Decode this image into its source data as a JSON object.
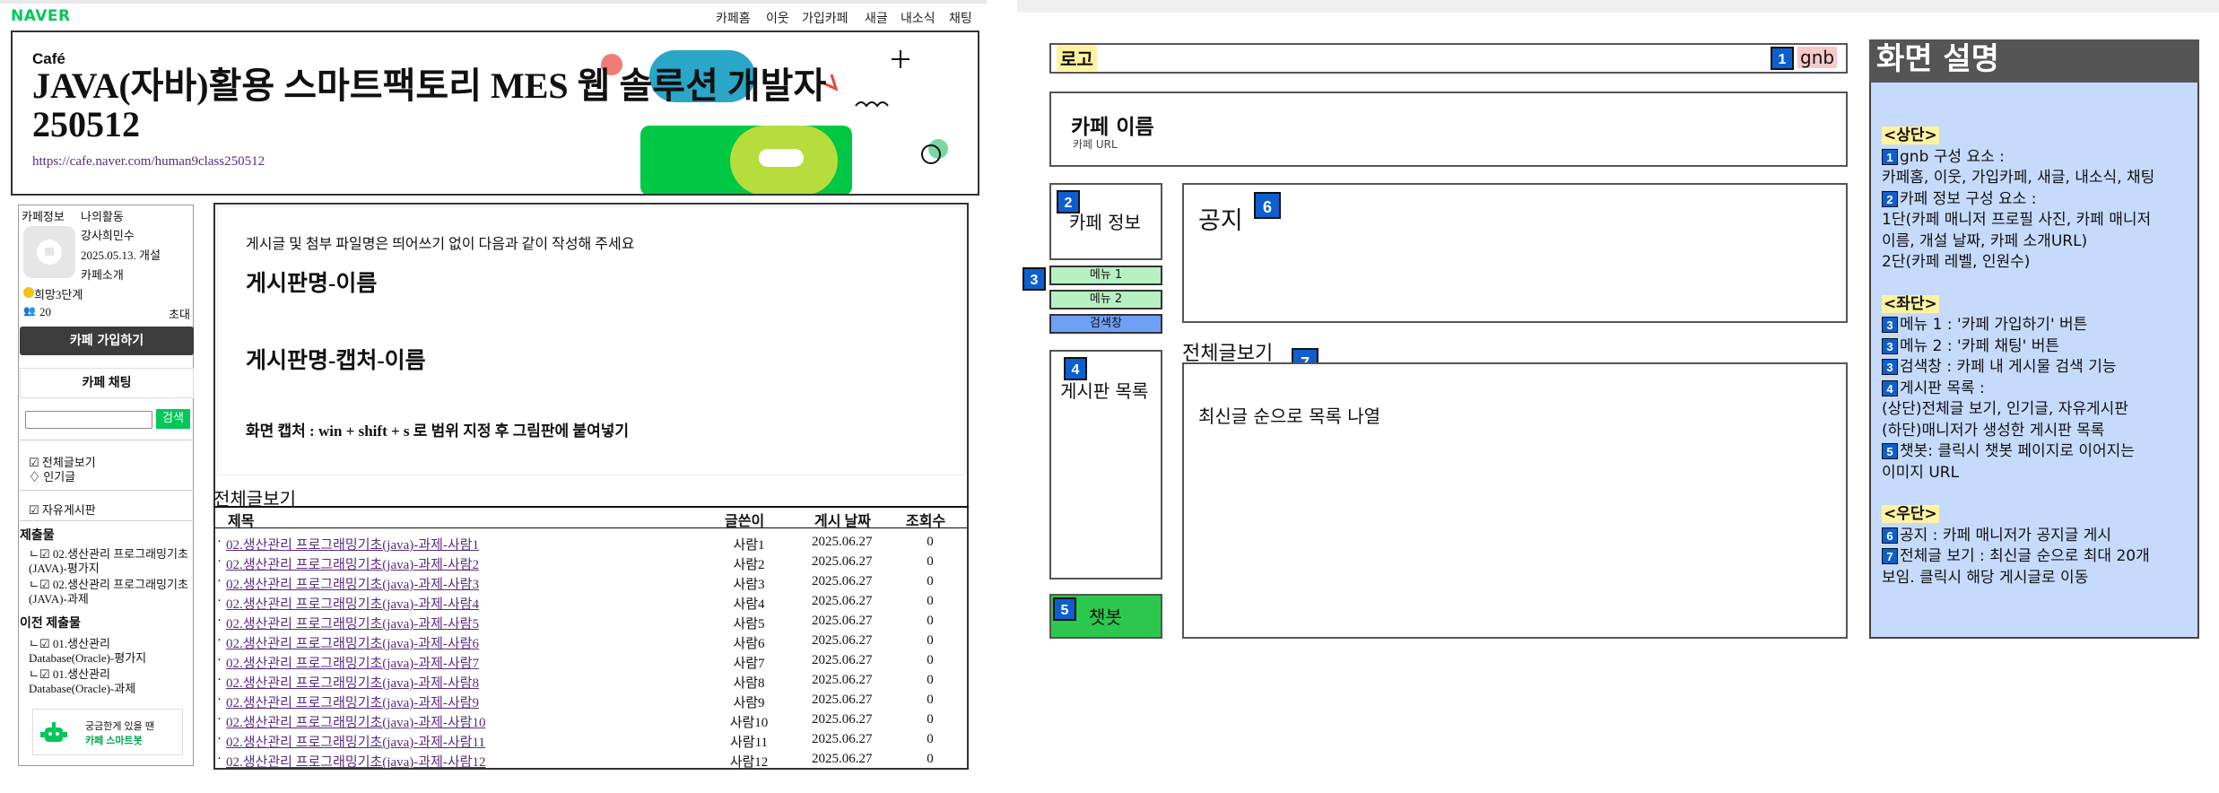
{
  "left": {
    "logo": "NAVER",
    "gnb": [
      "카페홈",
      "이웃",
      "가입카페",
      "새글",
      "내소식",
      "채팅"
    ],
    "cafe_mark": "Café",
    "cafe_title": "JAVA(자바)활용 스마트팩토리 MES 웹 솔루션 개발자 250512",
    "cafe_url": "https://cafe.naver.com/human9class250512",
    "side": {
      "tabs": [
        "카페정보",
        "나의활동"
      ],
      "manager": "강사희민수",
      "open_date": "2025.05.13. 개설",
      "intro": "카페소개",
      "level": "희망3단계",
      "members": "20",
      "invite": "초대",
      "join_label": "카페 가입하기",
      "chat_label": "카페 채팅",
      "search_label": "검색",
      "links": [
        "전체글보기",
        "인기글"
      ],
      "free_board": "자유게시판",
      "submit_head": "제출물",
      "submit_items": [
        "02.생산관리 프로그래밍기초(JAVA)-평가지",
        "02.생산관리 프로그래밍기초(JAVA)-과제"
      ],
      "prev_head": "이전 제출물",
      "prev_items": [
        "01.생산관리 Database(Oracle)-평가지",
        "01.생산관리 Database(Oracle)-과제"
      ],
      "chatbot_line1": "궁금한게 있을 땐",
      "chatbot_line2": "카페 스마트봇"
    },
    "notice": {
      "line1": "게시글 및 첨부 파일명은 띄어쓰기 없이 다음과 같이 작성해 주세요",
      "line2": "게시판명-이름",
      "line3": "게시판명-캡처-이름",
      "line4": "화면 캡처 : win + shift + s 로 범위 지정 후 그림판에 붙여넣기"
    },
    "list": {
      "title": "전체글보기",
      "headers": [
        "제목",
        "글쓴이",
        "게시 날짜",
        "조회수"
      ],
      "rows": [
        {
          "title": "02.생산관리 프로그래밍기초(java)-과제-사람1",
          "author": "사람1",
          "date": "2025.06.27",
          "views": "0"
        },
        {
          "title": "02.생산관리 프로그래밍기초(java)-과제-사람2",
          "author": "사람2",
          "date": "2025.06.27",
          "views": "0"
        },
        {
          "title": "02.생산관리 프로그래밍기초(java)-과제-사람3",
          "author": "사람3",
          "date": "2025.06.27",
          "views": "0"
        },
        {
          "title": "02.생산관리 프로그래밍기초(java)-과제-사람4",
          "author": "사람4",
          "date": "2025.06.27",
          "views": "0"
        },
        {
          "title": "02.생산관리 프로그래밍기초(java)-과제-사람5",
          "author": "사람5",
          "date": "2025.06.27",
          "views": "0"
        },
        {
          "title": "02.생산관리 프로그래밍기초(java)-과제-사람6",
          "author": "사람6",
          "date": "2025.06.27",
          "views": "0"
        },
        {
          "title": "02.생산관리 프로그래밍기초(java)-과제-사람7",
          "author": "사람7",
          "date": "2025.06.27",
          "views": "0"
        },
        {
          "title": "02.생산관리 프로그래밍기초(java)-과제-사람8",
          "author": "사람8",
          "date": "2025.06.27",
          "views": "0"
        },
        {
          "title": "02.생산관리 프로그래밍기초(java)-과제-사람9",
          "author": "사람9",
          "date": "2025.06.27",
          "views": "0"
        },
        {
          "title": "02.생산관리 프로그래밍기초(java)-과제-사람10",
          "author": "사람10",
          "date": "2025.06.27",
          "views": "0"
        },
        {
          "title": "02.생산관리 프로그래밍기초(java)-과제-사람11",
          "author": "사람11",
          "date": "2025.06.27",
          "views": "0"
        },
        {
          "title": "02.생산관리 프로그래밍기초(java)-과제-사람12",
          "author": "사람12",
          "date": "2025.06.27",
          "views": "0"
        }
      ]
    }
  },
  "wireframe": {
    "logo": "로고",
    "gnb": "gnb",
    "cafe_name": "카페 이름",
    "cafe_url": "카페 URL",
    "cafe_info": "카페 정보",
    "menu1": "메뉴 1",
    "menu2": "메뉴 2",
    "search": "검색창",
    "board_list": "게시판 목록",
    "chatbot": "챗봇",
    "notice": "공지",
    "all_posts": "전체글보기",
    "all_posts_desc": "최신글 순으로 목록 나열",
    "badges": [
      "1",
      "2",
      "3",
      "4",
      "5",
      "6",
      "7"
    ]
  },
  "description": {
    "title": "화면 설명",
    "top_head": "<상단>",
    "top_1": "gnb 구성 요소 :",
    "top_1b": "카페홈, 이웃, 가입카페, 새글, 내소식, 채팅",
    "top_2": "카페 정보 구성 요소 :",
    "top_2b": "1단(카페 매니저 프로필 사진, 카페 매니저",
    "top_2c": "이름, 개설 날짜, 카페 소개URL)",
    "top_2d": "2단(카페 레벨, 인원수)",
    "left_head": "<좌단>",
    "left_1": "메뉴 1 : '카페 가입하기' 버튼",
    "left_2": "메뉴 2 : '카페 채팅' 버튼",
    "left_3": "검색창 : 카페 내 게시물 검색 기능",
    "left_4": "게시판 목록 :",
    "left_4b": "(상단)전체글 보기, 인기글, 자유게시판",
    "left_4c": "(하단)매니저가 생성한 게시판 목록",
    "left_5": "챗봇: 클릭시 챗봇 페이지로 이어지는",
    "left_5b": "이미지 URL",
    "right_head": "<우단>",
    "right_6": "공지 : 카페 매니저가 공지글 게시",
    "right_7": "전체글 보기 : 최신글 순으로 최대 20개",
    "right_7b": "보임. 클릭시 해당 게시글로 이동"
  },
  "colors": {
    "naver_green": "#03c75a",
    "badge_blue": "#0d5fcf",
    "menu_green": "#b7f0c1",
    "search_blue": "#6fa0f5",
    "chatbot_green": "#2cc84d",
    "desc_bg": "#c6dafc",
    "highlight": "#fff3a0"
  }
}
